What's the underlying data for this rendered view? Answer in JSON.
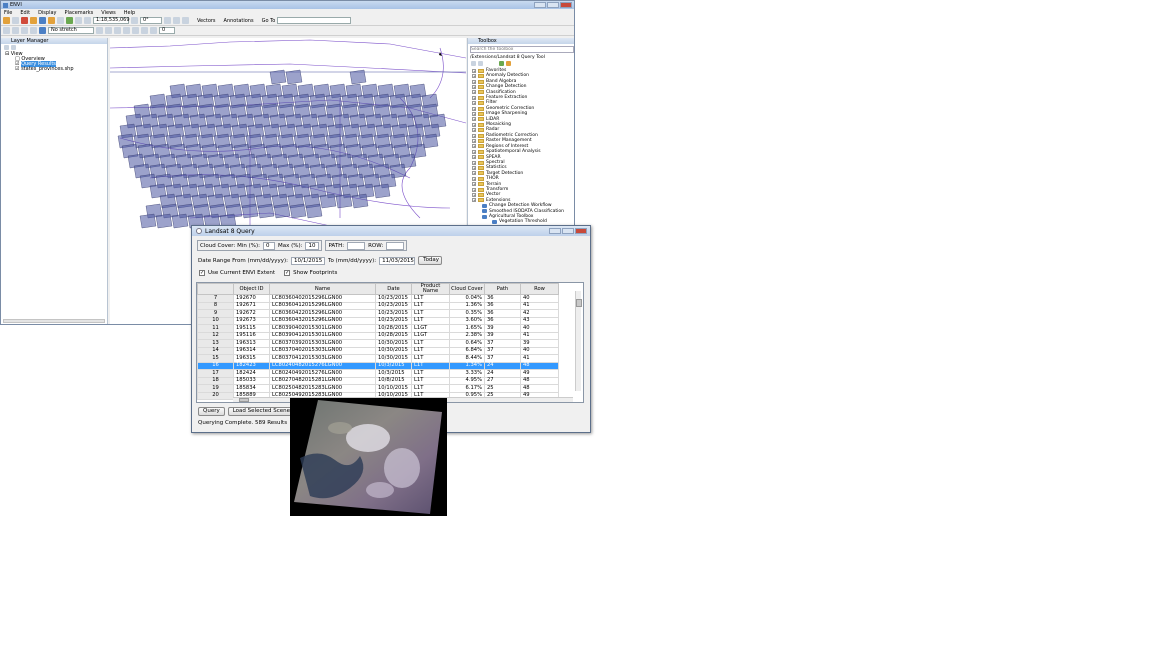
{
  "envi": {
    "title": "ENVI",
    "menu": [
      "File",
      "Edit",
      "Display",
      "Placemarks",
      "Views",
      "Help"
    ],
    "scale": "1:18,535,069",
    "rotation": "0°",
    "vectors_label": "Vectors",
    "annotations_label": "Annotations",
    "goto_label": "Go To",
    "stretch": "No stretch",
    "zero_value": "0",
    "layer_manager": {
      "title": "Layer Manager",
      "root": "View",
      "items": [
        "Overview",
        "Query Results",
        "states_provinces.shp"
      ]
    },
    "toolbox": {
      "title": "Toolbox",
      "search_placeholder": "Search the toolbox",
      "path": "/Extensions/Landsat 8 Query Tool",
      "folders": [
        "Favorites",
        "Anomaly Detection",
        "Band Algebra",
        "Change Detection",
        "Classification",
        "Feature Extraction",
        "Filter",
        "Geometric Correction",
        "Image Sharpening",
        "LiDAR",
        "Mosaicking",
        "Radar",
        "Radiometric Correction",
        "Raster Management",
        "Regions of Interest",
        "Spatiotemporal Analysis",
        "SPEAR",
        "Spectral",
        "Statistics",
        "Target Detection",
        "THOR",
        "Terrain",
        "Transform",
        "Vector",
        "Extensions"
      ],
      "extensions": [
        "Change Detection Workflow",
        "Smoothed ISODATA Classification",
        "Agricultural Toolbox",
        "Vegetation Threshold"
      ]
    }
  },
  "dialog": {
    "title": "Landsat 8 Query",
    "cloud_cover_label": "Cloud Cover: Min (%):",
    "cloud_min": "0",
    "max_label": "Max (%):",
    "cloud_max": "10",
    "path_label": "PATH:",
    "row_label": "ROW:",
    "date_from_label": "Date Range From (mm/dd/yyyy):",
    "date_from": "10/1/2015",
    "date_to_label": "To (mm/dd/yyyy):",
    "date_to": "11/03/2015",
    "today_button": "Today",
    "use_extent_label": "Use Current ENVI Extent",
    "show_footprints_label": "Show Footprints",
    "query_button": "Query",
    "load_button": "Load Selected Scene",
    "status": "Querying Complete. 589 Results",
    "columns": [
      "Object ID",
      "Name",
      "Date",
      "Product Name",
      "Cloud Cover",
      "Path",
      "Row"
    ],
    "rows": [
      [
        "7",
        "192670",
        "LC80360402015296LGN00",
        "10/23/2015",
        "L1T",
        "0.04%",
        "36",
        "40"
      ],
      [
        "8",
        "192671",
        "LC80360412015296LGN00",
        "10/23/2015",
        "L1T",
        "1.36%",
        "36",
        "41"
      ],
      [
        "9",
        "192672",
        "LC80360422015296LGN00",
        "10/23/2015",
        "L1T",
        "0.35%",
        "36",
        "42"
      ],
      [
        "10",
        "192673",
        "LC80360432015296LGN00",
        "10/23/2015",
        "L1T",
        "3.60%",
        "36",
        "43"
      ],
      [
        "11",
        "195115",
        "LC80390402015301LGN00",
        "10/28/2015",
        "L1GT",
        "1.65%",
        "39",
        "40"
      ],
      [
        "12",
        "195116",
        "LC80390412015301LGN00",
        "10/28/2015",
        "L1GT",
        "2.38%",
        "39",
        "41"
      ],
      [
        "13",
        "196313",
        "LC80370392015303LGN00",
        "10/30/2015",
        "L1T",
        "0.64%",
        "37",
        "39"
      ],
      [
        "14",
        "196314",
        "LC80370402015303LGN00",
        "10/30/2015",
        "L1T",
        "6.84%",
        "37",
        "40"
      ],
      [
        "15",
        "196315",
        "LC80370412015303LGN00",
        "10/30/2015",
        "L1T",
        "8.44%",
        "37",
        "41"
      ],
      [
        "16",
        "182423",
        "LC80240482015276LGN00",
        "10/3/2015",
        "L1T",
        "1.34%",
        "24",
        "48"
      ],
      [
        "17",
        "182424",
        "LC80240492015276LGN00",
        "10/3/2015",
        "L1T",
        "3.33%",
        "24",
        "49"
      ],
      [
        "18",
        "185033",
        "LC80270482015281LGN00",
        "10/8/2015",
        "L1T",
        "4.95%",
        "27",
        "48"
      ],
      [
        "19",
        "185834",
        "LC80250482015283LGN00",
        "10/10/2015",
        "L1T",
        "6.17%",
        "25",
        "48"
      ],
      [
        "20",
        "185889",
        "LC80250492015283LGN00",
        "10/10/2015",
        "L1T",
        "0.95%",
        "25",
        "49"
      ]
    ],
    "selected_row_index": 9
  },
  "colors": {
    "footprint": "#4a55a0",
    "selection": "#3399ff",
    "boundary": "#7a4ec9"
  }
}
